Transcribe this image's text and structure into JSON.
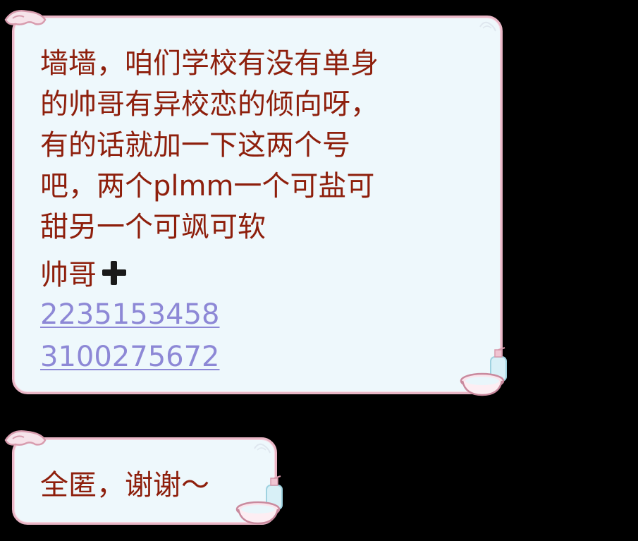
{
  "messages": [
    {
      "lines": [
        "墙墙，咱们学校有没有单身",
        "的帅哥有异校恋的倾向呀，",
        "有的话就加一下这两个号",
        "吧，两个plmm一个可盐可",
        "甜另一个可飒可软"
      ],
      "label": "帅哥",
      "plus_icon": "plus-icon",
      "links": [
        "2235153458",
        "3100275672"
      ]
    },
    {
      "text": "全匿，谢谢～"
    }
  ],
  "colors": {
    "background": "#000000",
    "bubble_fill": "#eef8fc",
    "bubble_border": "#e9b6c6",
    "message_text": "#8e1f0c",
    "link_text": "#8d88d6"
  },
  "decorations": {
    "top_left_icon": "goggles-icon",
    "bottom_right_icon": "basin-bottle-icon",
    "top_right_icon": "swirl-icon"
  }
}
